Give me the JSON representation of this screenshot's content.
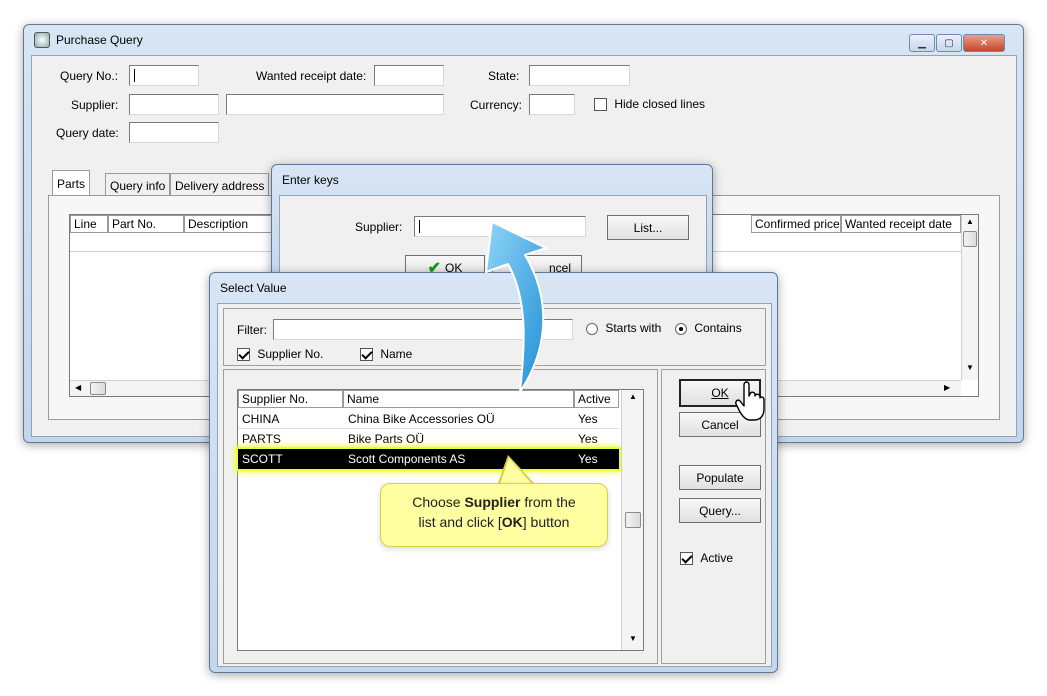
{
  "purchase_query": {
    "title": "Purchase Query",
    "query_no_label": "Query No.:",
    "wanted_receipt_label": "Wanted receipt date:",
    "state_label": "State:",
    "supplier_label": "Supplier:",
    "currency_label": "Currency:",
    "hide_closed_label": "Hide closed lines",
    "query_date_label": "Query date:",
    "tabs": [
      "Parts",
      "Query info",
      "Delivery address"
    ],
    "columns_left": [
      "Line",
      "Part No.",
      "Description"
    ],
    "columns_right": [
      "Confirmed price",
      "Wanted receipt date"
    ]
  },
  "enter_keys": {
    "title": "Enter keys",
    "supplier_label": "Supplier:",
    "list_button": "List...",
    "ok_button": "OK",
    "cancel_button_partial": "ncel"
  },
  "select_value": {
    "title": "Select Value",
    "filter_label": "Filter:",
    "starts_with_label": "Starts with",
    "contains_label": "Contains",
    "supplier_no_check": "Supplier No.",
    "name_check": "Name",
    "columns": [
      "Supplier No.",
      "Name",
      "Active"
    ],
    "rows": [
      {
        "no": "CHINA",
        "name": "China Bike Accessories OÜ",
        "active": "Yes"
      },
      {
        "no": "PARTS",
        "name": "Bike Parts OÜ",
        "active": "Yes"
      },
      {
        "no": "SCOTT",
        "name": "Scott Components AS",
        "active": "Yes"
      }
    ],
    "ok_button": "OK",
    "cancel_button": "Cancel",
    "populate_button": "Populate",
    "query_button": "Query...",
    "active_check": "Active"
  },
  "tooltip": {
    "pre": "Choose ",
    "bold1": "Supplier",
    "mid": " from the",
    "line2_pre": "list and click [",
    "bold2": "OK",
    "line2_post": "] button"
  },
  "colors": {
    "highlight": "#eaff3a",
    "arrow": "#3aa8e6",
    "tooltip_bg": "#fffea0"
  }
}
